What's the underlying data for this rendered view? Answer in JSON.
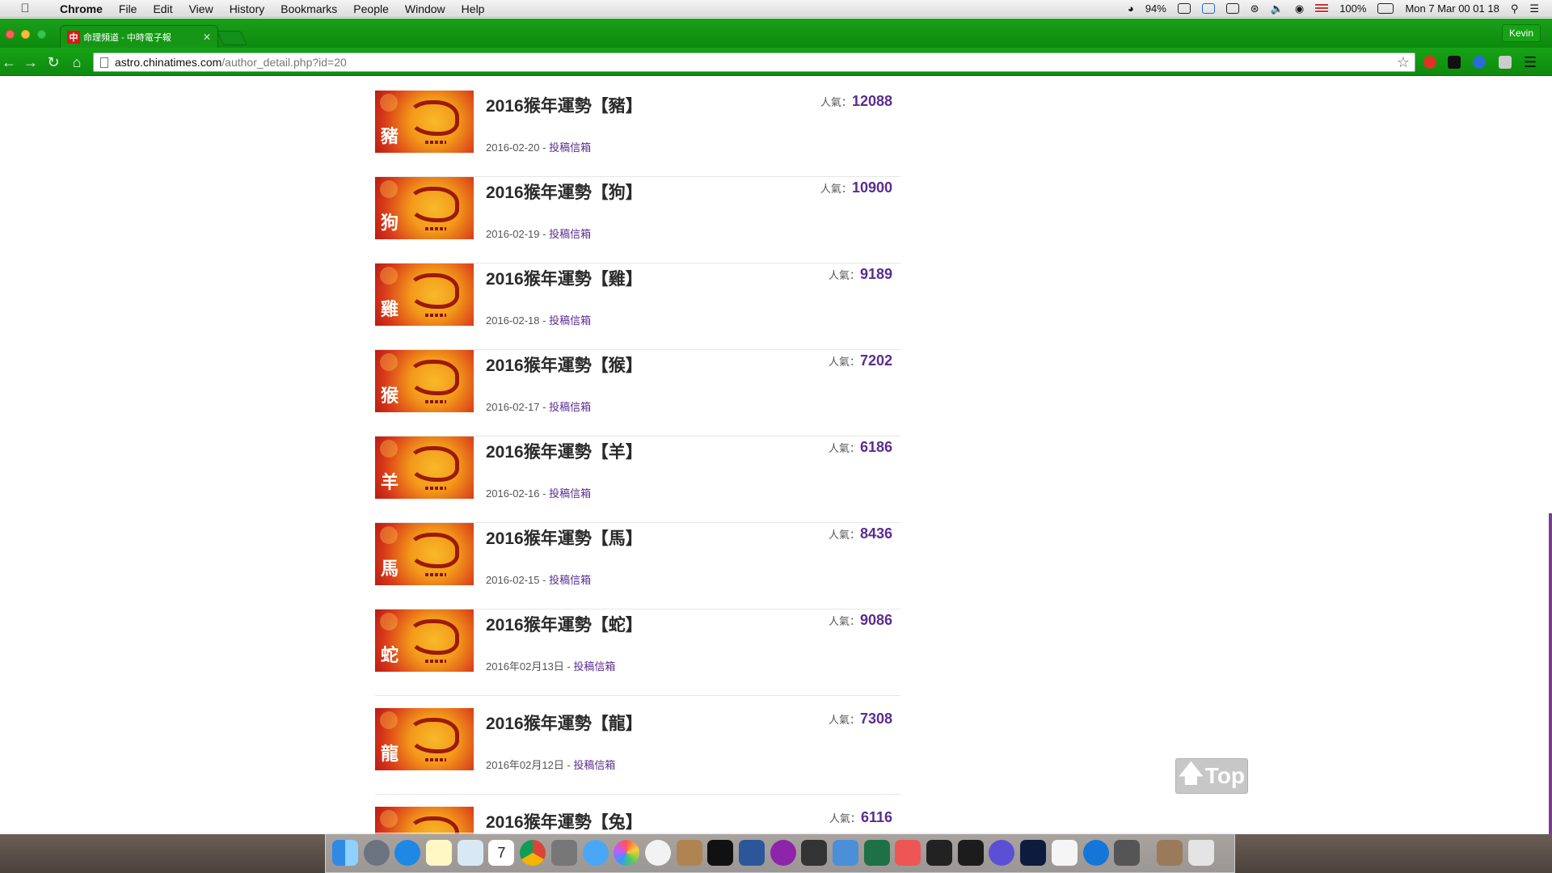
{
  "menubar": {
    "app": "Chrome",
    "menus": [
      "File",
      "Edit",
      "View",
      "History",
      "Bookmarks",
      "People",
      "Window",
      "Help"
    ],
    "status": {
      "cpu": "94%",
      "battery": "100%",
      "clock": "Mon 7 Mar  00 01 18"
    }
  },
  "browser": {
    "tab_title": "命理頻道 - 中時電子報",
    "tab_favicon": "中",
    "profile": "Kevin",
    "url_host": "astro.chinatimes.com",
    "url_path": "/author_detail.php?id=20"
  },
  "articles": [
    {
      "title": "2016猴年運勢【豬】",
      "zodiac": "豬",
      "date": "2016-02-20",
      "separator": " - ",
      "link": "投稿信箱",
      "pop_label": "人氣：",
      "pop": "12088"
    },
    {
      "title": "2016猴年運勢【狗】",
      "zodiac": "狗",
      "date": "2016-02-19",
      "separator": " - ",
      "link": "投稿信箱",
      "pop_label": "人氣：",
      "pop": "10900"
    },
    {
      "title": "2016猴年運勢【雞】",
      "zodiac": "雞",
      "date": "2016-02-18",
      "separator": " - ",
      "link": "投稿信箱",
      "pop_label": "人氣：",
      "pop": "9189"
    },
    {
      "title": "2016猴年運勢【猴】",
      "zodiac": "猴",
      "date": "2016-02-17",
      "separator": " - ",
      "link": "投稿信箱",
      "pop_label": "人氣：",
      "pop": "7202"
    },
    {
      "title": "2016猴年運勢【羊】",
      "zodiac": "羊",
      "date": "2016-02-16",
      "separator": " - ",
      "link": "投稿信箱",
      "pop_label": "人氣：",
      "pop": "6186"
    },
    {
      "title": "2016猴年運勢【馬】",
      "zodiac": "馬",
      "date": "2016-02-15",
      "separator": " - ",
      "link": "投稿信箱",
      "pop_label": "人氣：",
      "pop": "8436"
    },
    {
      "title": "2016猴年運勢【蛇】",
      "zodiac": "蛇",
      "date": "2016年02月13日",
      "separator": " - ",
      "link": "投稿信箱",
      "pop_label": "人氣：",
      "pop": "9086"
    },
    {
      "title": "2016猴年運勢【龍】",
      "zodiac": "龍",
      "date": "2016年02月12日",
      "separator": " - ",
      "link": "投稿信箱",
      "pop_label": "人氣：",
      "pop": "7308"
    },
    {
      "title": "2016猴年運勢【兔】",
      "zodiac": "兔",
      "date": "",
      "separator": "",
      "link": "",
      "pop_label": "人氣：",
      "pop": "6116"
    }
  ],
  "top_button": {
    "label": "Top",
    "icon": "arrow-up-icon"
  },
  "dock": {
    "icons": [
      "finder-icon",
      "launchpad-icon",
      "safari-icon",
      "notes-icon",
      "preview-icon",
      "calendar-icon",
      "chrome-icon",
      "system-app-icon",
      "messages-icon",
      "photos-icon",
      "itunes-icon",
      "contacts-icon",
      "gopro-icon",
      "word-icon",
      "podcast-icon",
      "imovie-icon",
      "xcode-icon",
      "excel-icon",
      "keynote-icon",
      "terminal-icon",
      "activity-monitor-icon",
      "imovie-star-icon",
      "photoshop-icon",
      "textedit-icon",
      "teamviewer-icon",
      "screen-icon",
      "book-icon",
      "trash-icon"
    ],
    "calendar_day": "7"
  }
}
